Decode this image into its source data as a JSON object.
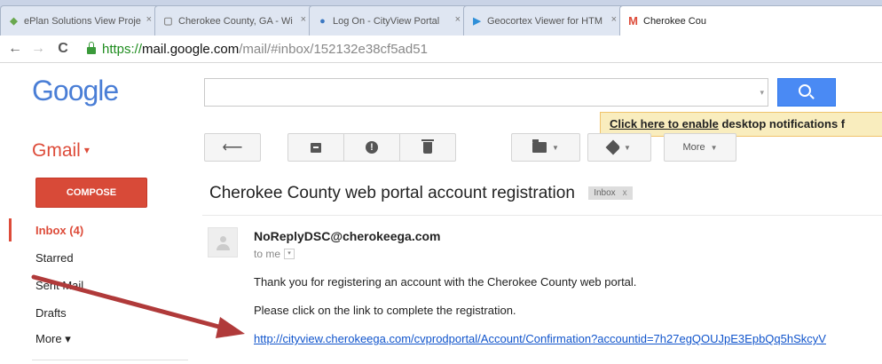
{
  "browser": {
    "tabs": [
      {
        "title": "ePlan Solutions View Proje",
        "icon": "eplan-icon"
      },
      {
        "title": "Cherokee County, GA - Wi",
        "icon": "page-icon"
      },
      {
        "title": "Log On - CityView Portal",
        "icon": "cityview-icon"
      },
      {
        "title": "Geocortex Viewer for HTM",
        "icon": "geocortex-icon"
      },
      {
        "title": "Cherokee Cou",
        "icon": "gmail-m-icon"
      }
    ],
    "close_glyph": "×",
    "url_scheme": "https://",
    "url_host": "mail.google.com",
    "url_path": "/mail/#inbox/152132e38cf5ad51"
  },
  "header": {
    "logo": "Google",
    "notification_link": "Click here to enable",
    "notification_text": " desktop notifications f"
  },
  "gmail": {
    "label": "Gmail",
    "caret": "▾",
    "more_label": "More"
  },
  "sidebar": {
    "compose": "COMPOSE",
    "items": [
      {
        "label": "Inbox (4)"
      },
      {
        "label": "Starred"
      },
      {
        "label": "Sent Mail"
      },
      {
        "label": "Drafts"
      },
      {
        "label": "More ▾"
      }
    ]
  },
  "message": {
    "subject": "Cherokee County web portal account registration",
    "chip_label": "Inbox",
    "chip_close": "x",
    "sender": "NoReplyDSC@cherokeega.com",
    "to": "to me",
    "lines": [
      "Thank you for registering an account with the Cherokee County web portal.",
      "Please click on the link to complete the registration."
    ],
    "link": "http://cityview.cherokeega.com/cvprodportal/Account/Confirmation?accountid=7h27egQOUJpE3EpbQq5hSkcyV"
  },
  "colors": {
    "gmail_red": "#dd4b39",
    "search_blue": "#4a8af4",
    "link_blue": "#1155cc",
    "annotation_arrow": "#b03a3a"
  }
}
